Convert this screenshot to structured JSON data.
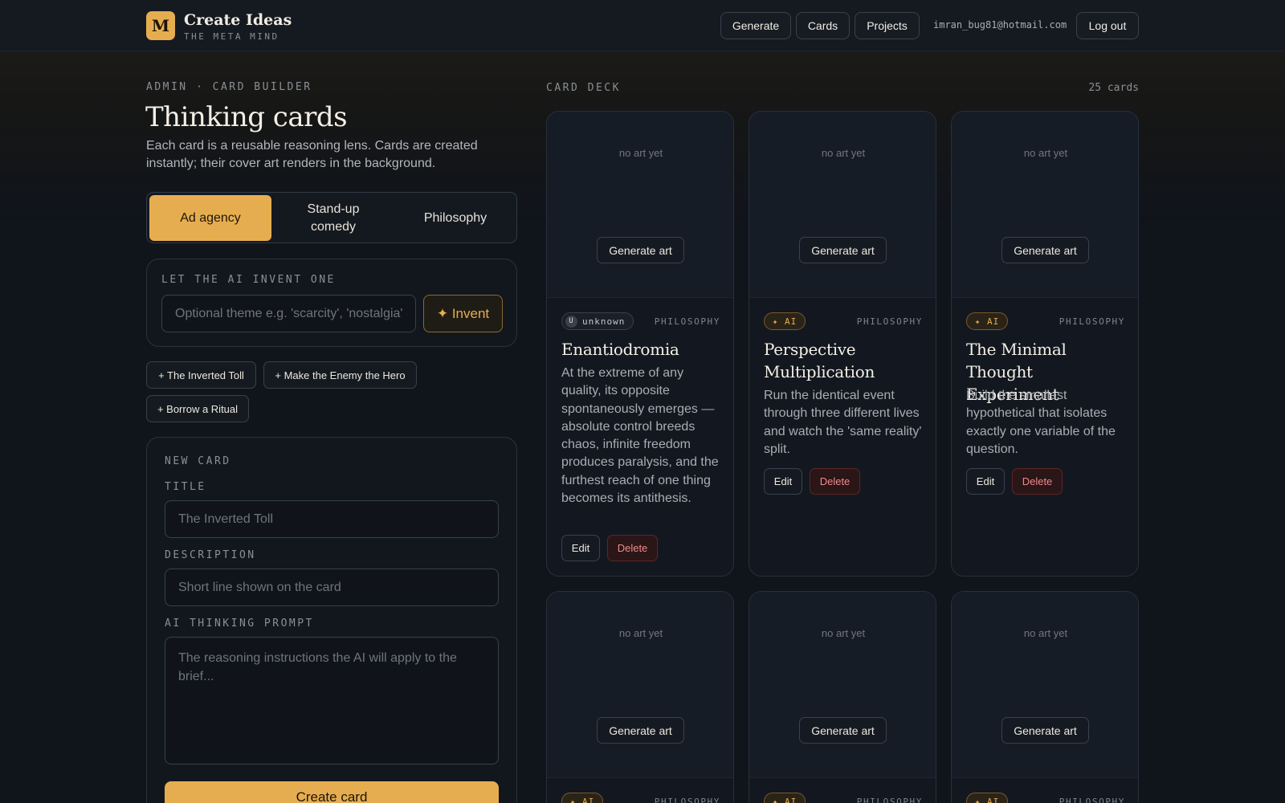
{
  "header": {
    "logo_letter": "M",
    "brand_title": "Create Ideas",
    "brand_subtitle": "THE META MIND",
    "nav": {
      "generate": "Generate",
      "cards": "Cards",
      "projects": "Projects"
    },
    "user_email": "imran_bug81@hotmail.com",
    "logout": "Log out"
  },
  "builder": {
    "eyebrow": "ADMIN · CARD BUILDER",
    "title": "Thinking cards",
    "description": "Each card is a reusable reasoning lens. Cards are created instantly; their cover art renders in the background.",
    "segments": [
      {
        "label": "Ad agency",
        "active": true
      },
      {
        "label": "Stand-up comedy",
        "active": false
      },
      {
        "label": "Philosophy",
        "active": false
      }
    ],
    "invent": {
      "label": "LET THE AI INVENT ONE",
      "placeholder": "Optional theme e.g. 'scarcity', 'nostalgia'",
      "value": "",
      "button": "✦ Invent"
    },
    "suggestions": [
      "+ The Inverted Toll",
      "+ Make the Enemy the Hero",
      "+ Borrow a Ritual"
    ],
    "new_card": {
      "label": "NEW CARD",
      "title_label": "TITLE",
      "title_placeholder": "The Inverted Toll",
      "title_value": "",
      "desc_label": "DESCRIPTION",
      "desc_placeholder": "Short line shown on the card",
      "desc_value": "",
      "prompt_label": "AI THINKING PROMPT",
      "prompt_placeholder": "The reasoning instructions the AI will apply to the brief...",
      "prompt_value": "",
      "create_button": "Create card"
    }
  },
  "deck": {
    "label": "CARD DECK",
    "count": "25 cards",
    "cards": [
      {
        "no_art": "no art yet",
        "generate_art": "Generate art",
        "badge": "unknown",
        "badge_icon": "U",
        "category": "PHILOSOPHY",
        "title": "Enantiodromia",
        "description": "At the extreme of any quality, its opposite spontaneously emerges — absolute control breeds chaos, infinite freedom produces paralysis, and the furthest reach of one thing becomes its antithesis.",
        "edit": "Edit",
        "delete": "Delete"
      },
      {
        "no_art": "no art yet",
        "generate_art": "Generate art",
        "badge": "✦ AI",
        "category": "PHILOSOPHY",
        "title": "Perspective Multiplication",
        "description": "Run the identical event through three different lives and watch the 'same reality' split.",
        "edit": "Edit",
        "delete": "Delete"
      },
      {
        "no_art": "no art yet",
        "generate_art": "Generate art",
        "badge": "✦ AI",
        "category": "PHILOSOPHY",
        "title": "The Minimal Thought Experiment",
        "description": "Build the smallest hypothetical that isolates exactly one variable of the question.",
        "edit": "Edit",
        "delete": "Delete"
      },
      {
        "no_art": "no art yet",
        "generate_art": "Generate art",
        "badge": "✦ AI",
        "category": "PHILOSOPHY"
      },
      {
        "no_art": "no art yet",
        "generate_art": "Generate art",
        "badge": "✦ AI",
        "category": "PHILOSOPHY"
      },
      {
        "no_art": "no art yet",
        "generate_art": "Generate art",
        "badge": "✦ AI",
        "category": "PHILOSOPHY"
      }
    ]
  },
  "colors": {
    "accent": "#e6ad50",
    "background": "#10141b",
    "danger": "#f08a8a"
  }
}
